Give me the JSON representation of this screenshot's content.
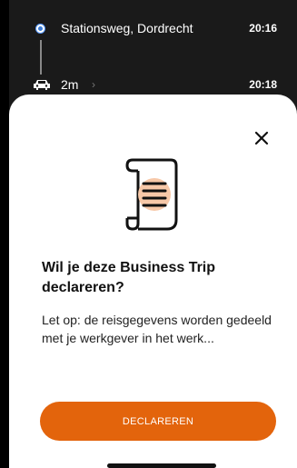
{
  "trip": {
    "origin": "Stationsweg, Dordrecht",
    "origin_time": "20:16",
    "distance": "2m",
    "distance_chevron": "›",
    "distance_time": "20:18"
  },
  "sheet": {
    "close_icon": "close-icon",
    "illustration_icon": "receipt-scroll-icon",
    "title": "Wil je deze Business Trip declareren?",
    "description": "Let op: de reisgegevens worden gedeeld met je werkgever in het werk...",
    "cta_label": "DECLAREREN"
  },
  "colors": {
    "accent": "#e3640c",
    "illustration_fill": "#f7c8a8",
    "route_dot": "#3a7bd5"
  }
}
